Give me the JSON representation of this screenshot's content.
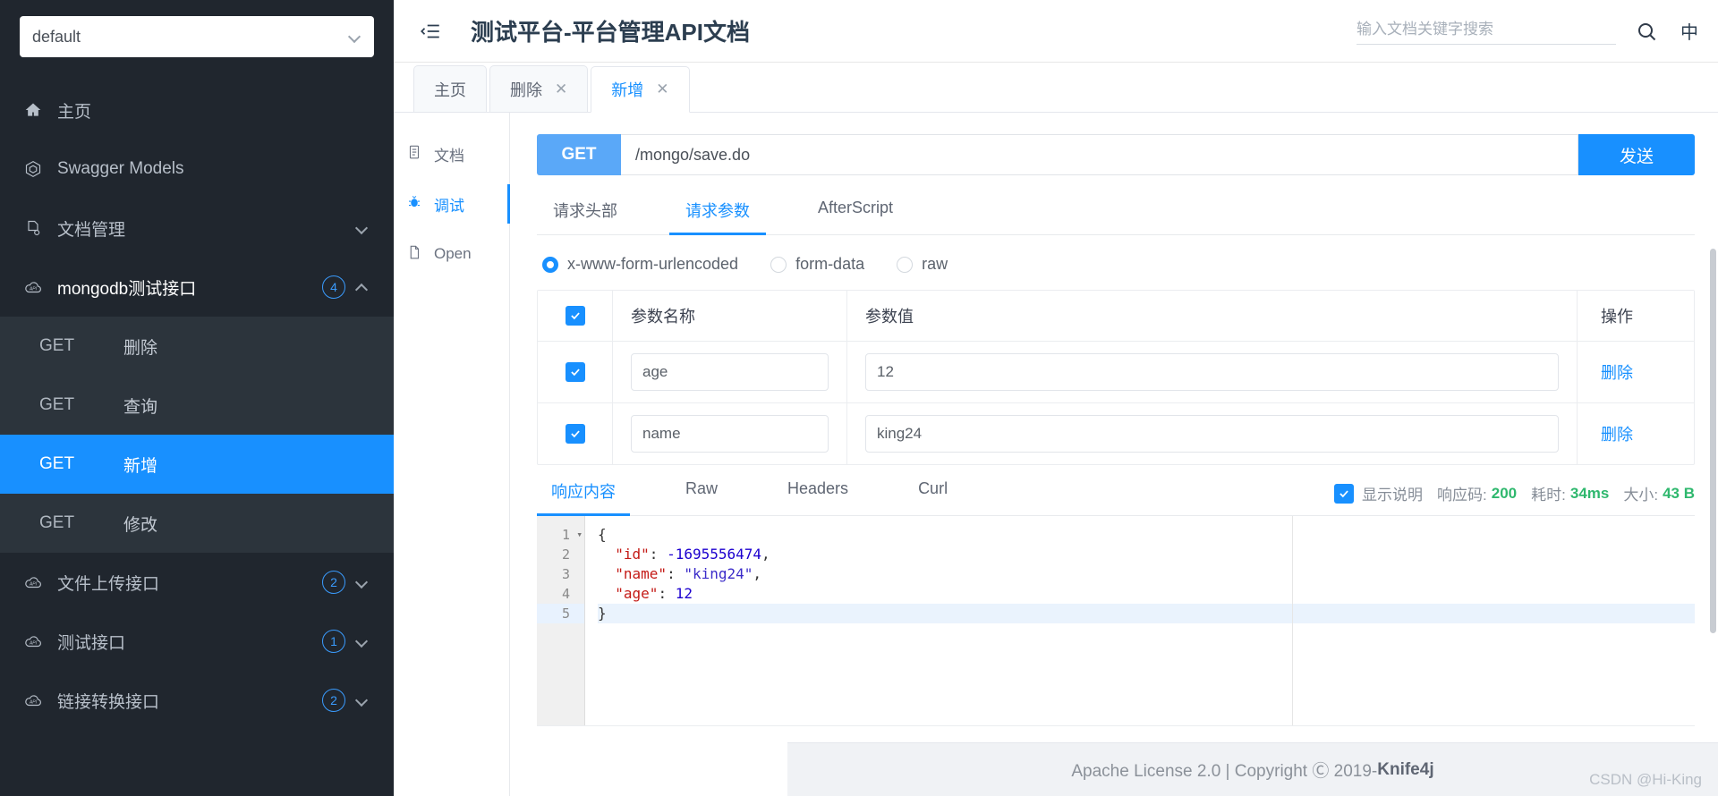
{
  "sidebar": {
    "project_selector": {
      "value": "default",
      "icon": "chevron-down-icon"
    },
    "nav": [
      {
        "label": "主页",
        "icon": "home-icon",
        "type": "link"
      },
      {
        "label": "Swagger Models",
        "icon": "cube-icon",
        "type": "link"
      },
      {
        "label": "文档管理",
        "icon": "document-settings-icon",
        "type": "group",
        "expand": "chevron-down-icon"
      },
      {
        "label": "mongodb测试接口",
        "icon": "api-cloud-icon",
        "type": "group",
        "badge": "4",
        "expand": "chevron-up-icon",
        "expanded": true
      }
    ],
    "mongodb_children": [
      {
        "method": "GET",
        "label": "删除",
        "active": false
      },
      {
        "method": "GET",
        "label": "查询",
        "active": false
      },
      {
        "method": "GET",
        "label": "新增",
        "active": true
      },
      {
        "method": "GET",
        "label": "修改",
        "active": false
      }
    ],
    "nav_bottom": [
      {
        "label": "文件上传接口",
        "icon": "api-cloud-icon",
        "badge": "2",
        "expand": "chevron-down-icon"
      },
      {
        "label": "测试接口",
        "icon": "api-cloud-icon",
        "badge": "1",
        "expand": "chevron-down-icon"
      },
      {
        "label": "链接转换接口",
        "icon": "api-cloud-icon",
        "badge": "2",
        "expand": "chevron-down-icon"
      }
    ]
  },
  "header": {
    "collapse_icon": "menu-fold-icon",
    "title": "测试平台-平台管理API文档",
    "search_placeholder": "输入文档关键字搜索",
    "search_value": "",
    "search_icon": "search-icon",
    "lang_label": "中"
  },
  "tabs": [
    {
      "label": "主页",
      "closable": false,
      "active": false
    },
    {
      "label": "删除",
      "closable": true,
      "close_label": "✕",
      "active": false
    },
    {
      "label": "新增",
      "closable": true,
      "close_label": "✕",
      "active": true
    }
  ],
  "side_tabs": [
    {
      "label": "文档",
      "icon": "document-icon",
      "active": false
    },
    {
      "label": "调试",
      "icon": "bug-icon",
      "active": true
    },
    {
      "label": "Open",
      "icon": "file-icon",
      "active": false
    }
  ],
  "request": {
    "method": "GET",
    "url": "/mongo/save.do",
    "url_placeholder": "",
    "send_label": "发送",
    "tabs": [
      {
        "label": "请求头部",
        "active": false
      },
      {
        "label": "请求参数",
        "active": true
      },
      {
        "label": "AfterScript",
        "active": false
      }
    ],
    "body_types": [
      {
        "label": "x-www-form-urlencoded",
        "selected": true
      },
      {
        "label": "form-data",
        "selected": false
      },
      {
        "label": "raw",
        "selected": false
      }
    ],
    "table": {
      "headers": {
        "name": "参数名称",
        "value": "参数值",
        "operation": "操作"
      },
      "select_all_checked": true,
      "rows": [
        {
          "checked": true,
          "name": "age",
          "value": "12",
          "delete_label": "删除"
        },
        {
          "checked": true,
          "name": "name",
          "value": "king24",
          "delete_label": "删除"
        }
      ]
    }
  },
  "response": {
    "tabs": [
      {
        "label": "响应内容",
        "active": true
      },
      {
        "label": "Raw",
        "active": false
      },
      {
        "label": "Headers",
        "active": false
      },
      {
        "label": "Curl",
        "active": false
      }
    ],
    "show_desc_label": "显示说明",
    "show_desc_checked": true,
    "status_label": "响应码:",
    "status_value": "200",
    "time_label": "耗时:",
    "time_value": "34ms",
    "size_label": "大小:",
    "size_value": "43 B",
    "code_lines": [
      {
        "no": "1",
        "fold": true,
        "segments": [
          {
            "t": "{",
            "c": "p"
          }
        ]
      },
      {
        "no": "2",
        "fold": false,
        "segments": [
          {
            "t": "  ",
            "c": "p"
          },
          {
            "t": "\"id\"",
            "c": "k"
          },
          {
            "t": ": ",
            "c": "p"
          },
          {
            "t": "-1695556474",
            "c": "n"
          },
          {
            "t": ",",
            "c": "p"
          }
        ]
      },
      {
        "no": "3",
        "fold": false,
        "segments": [
          {
            "t": "  ",
            "c": "p"
          },
          {
            "t": "\"name\"",
            "c": "k"
          },
          {
            "t": ": ",
            "c": "p"
          },
          {
            "t": "\"king24\"",
            "c": "s"
          },
          {
            "t": ",",
            "c": "p"
          }
        ]
      },
      {
        "no": "4",
        "fold": false,
        "segments": [
          {
            "t": "  ",
            "c": "p"
          },
          {
            "t": "\"age\"",
            "c": "k"
          },
          {
            "t": ": ",
            "c": "p"
          },
          {
            "t": "12",
            "c": "n"
          }
        ]
      },
      {
        "no": "5",
        "fold": false,
        "current": true,
        "segments": [
          {
            "t": "}",
            "c": "p"
          }
        ]
      }
    ]
  },
  "footer": {
    "license": "Apache License 2.0 | Copyright Ⓒ 2019-",
    "brand": "Knife4j",
    "watermark": "CSDN @Hi-King"
  },
  "colors": {
    "accent": "#1890ff",
    "sidebar_bg": "#20262e",
    "sidebar_sub_bg": "#2c343c",
    "success": "#2fb86e"
  }
}
